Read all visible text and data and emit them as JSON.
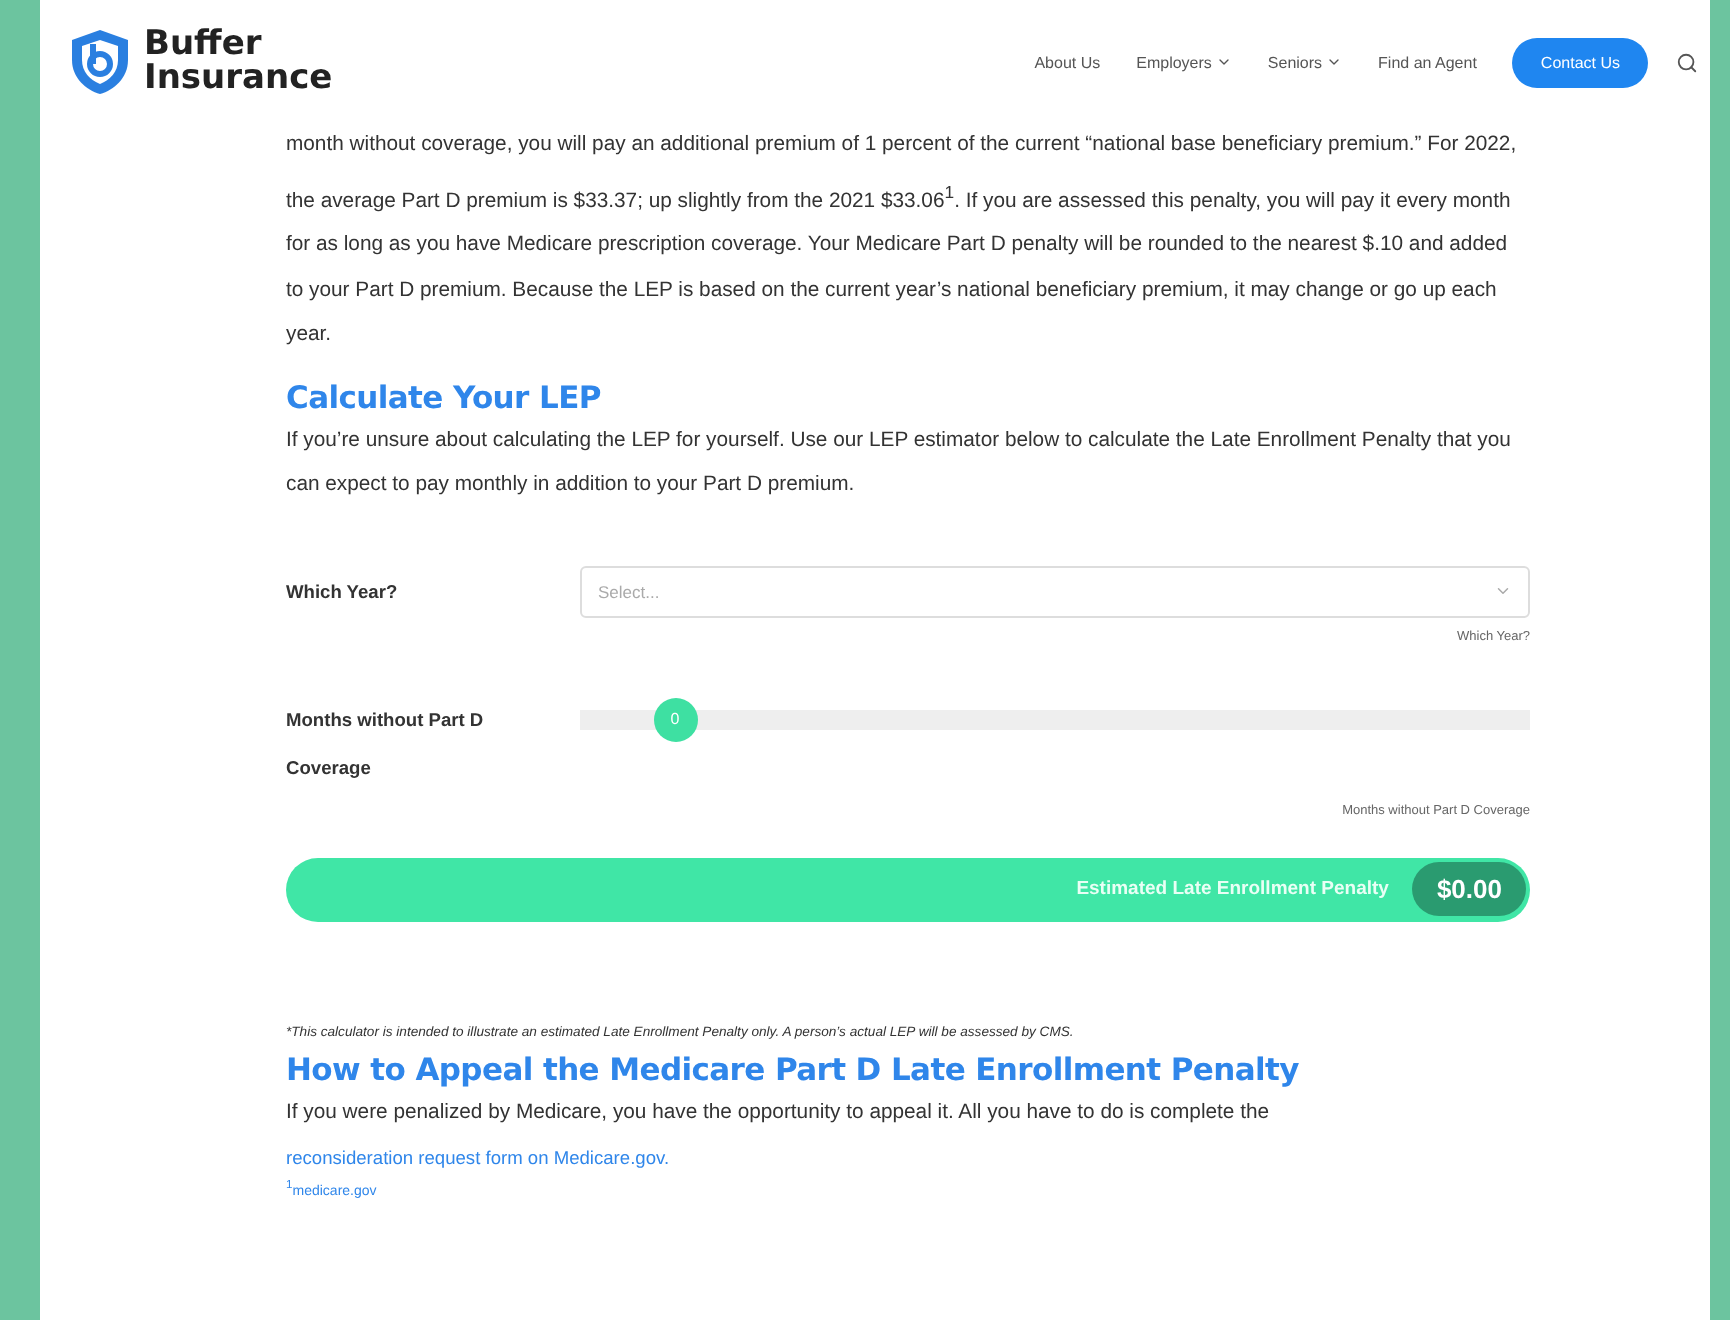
{
  "header": {
    "logo_line_1": "Buffer",
    "logo_line_2": "Insurance",
    "nav": [
      {
        "label": "About Us",
        "dropdown": false
      },
      {
        "label": "Employers",
        "dropdown": true
      },
      {
        "label": "Seniors",
        "dropdown": true
      },
      {
        "label": "Find an Agent",
        "dropdown": false
      }
    ],
    "cta": "Contact Us"
  },
  "intro": "month without coverage, you will pay an additional premium of 1 percent of the current “national base beneficiary premium.” For 2022, the average Part D premium is $33.37; up slightly from the 2021 $33.06$^{1}$. If you are assessed this penalty, you will pay it every month for as long as you have Medicare prescription coverage. Your Medicare Part D penalty will be rounded to the nearest $.10 and added to your Part D premium. Because the LEP is based on the current year’s national beneficiary premium, it may change or go up each year.",
  "calc_heading": "Calculate Your LEP",
  "calc_text": "If you’re unsure about calculating the LEP for yourself. Use our LEP estimator below to calculate the Late Enrollment Penalty that you can expect to pay monthly in addition to your Part D premium.",
  "year": {
    "label": "Which Year?",
    "placeholder": "Select...",
    "help": "Which Year?"
  },
  "months": {
    "label": "Months without Part D Coverage",
    "thumb": "0",
    "level": 0.1,
    "help": "Months without Part D Coverage"
  },
  "result": {
    "label": "Estimated Late Enrollment Penalty",
    "value": "$0.00"
  },
  "disclaimer": "*This calculator is intended to illustrate an estimated Late Enrollment Penalty only. A person’s actual LEP will be assessed by CMS.",
  "appeal_heading": "How to Appeal the Medicare Part D Late Enrollment Penalty",
  "appeal_text": "If you were penalized by Medicare, you have the opportunity to appeal it. All you have to do is complete the",
  "appeal_link": "reconsideration request form on Medicare.gov.",
  "footnote_mark": "1",
  "footnote_link": "medicare.gov"
}
